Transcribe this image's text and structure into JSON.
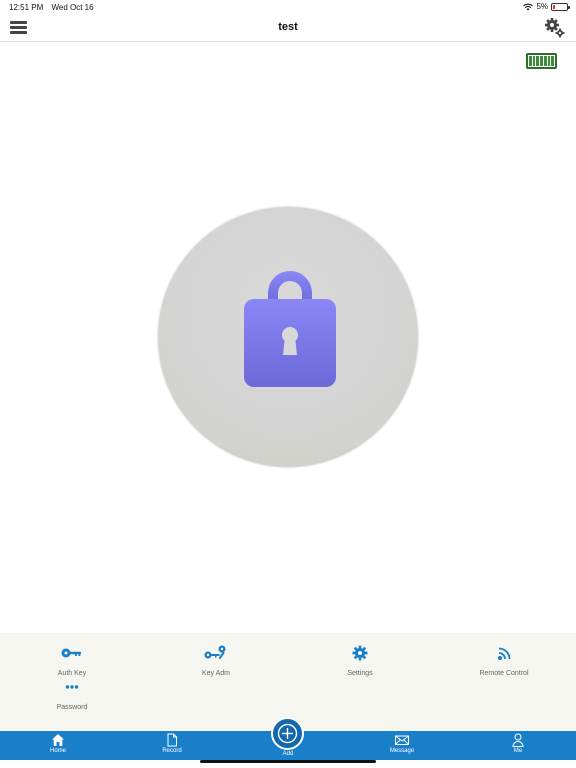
{
  "status_bar": {
    "time": "12:51 PM",
    "date": "Wed Oct 16",
    "battery_percent": "5%"
  },
  "header": {
    "title": "test",
    "menu_icon": "hamburger-menu-icon",
    "settings_icon": "gears-icon"
  },
  "lock": {
    "state_icon": "padlock-icon",
    "battery_level": 1.0,
    "colors": {
      "lock_gradient_top": "#8a86f6",
      "lock_gradient_bottom": "#6b6ad8",
      "battery_green": "#2d6e2d"
    }
  },
  "functions": [
    {
      "label": "Auth Key",
      "icon": "key-icon"
    },
    {
      "label": "Key Adm",
      "icon": "key-admin-icon"
    },
    {
      "label": "Settings",
      "icon": "gear-icon"
    },
    {
      "label": "Remote Control",
      "icon": "remote-signal-icon"
    },
    {
      "label": "Password",
      "icon": "password-dots-icon"
    }
  ],
  "tabs": [
    {
      "label": "Home",
      "icon": "home-icon"
    },
    {
      "label": "Record",
      "icon": "document-icon"
    },
    {
      "label": "Add",
      "icon": "plus-circle-icon"
    },
    {
      "label": "Message",
      "icon": "envelope-icon"
    },
    {
      "label": "Me",
      "icon": "person-icon"
    }
  ],
  "colors": {
    "accent": "#1a7fc9",
    "panel_bg": "#f4f6ef",
    "icon_blue": "#1a7fc9"
  }
}
